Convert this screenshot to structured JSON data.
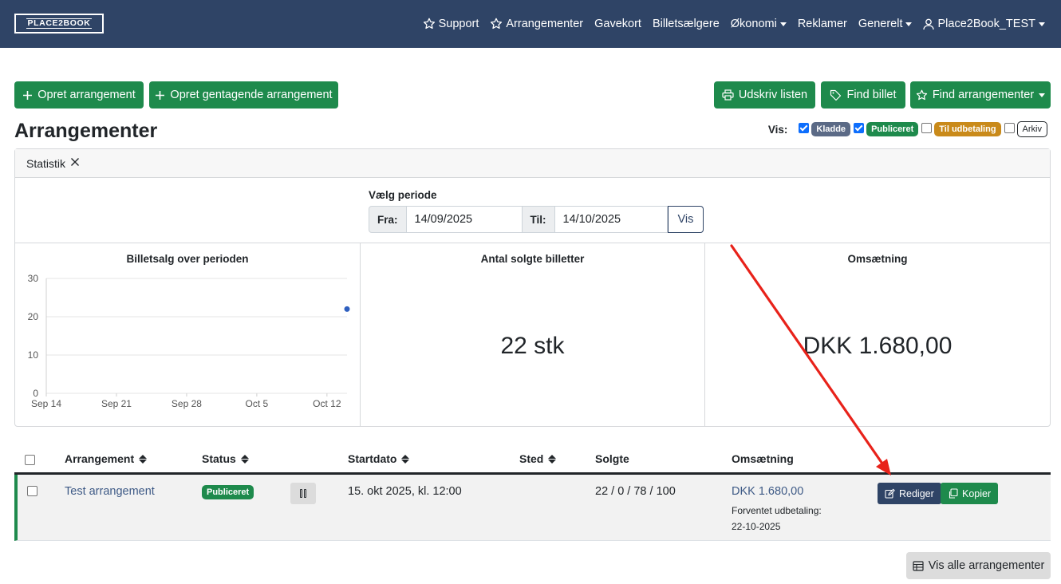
{
  "nav": {
    "logo": "PLACE2BOOK",
    "items": [
      {
        "label": "Support",
        "icon": "star-icon"
      },
      {
        "label": "Arrangementer",
        "icon": "star-icon"
      },
      {
        "label": "Gavekort"
      },
      {
        "label": "Billetsælgere"
      },
      {
        "label": "Økonomi",
        "dropdown": true
      },
      {
        "label": "Reklamer"
      },
      {
        "label": "Generelt",
        "dropdown": true
      },
      {
        "label": "Place2Book_TEST",
        "icon": "user-icon",
        "dropdown": true
      }
    ]
  },
  "toolbar": {
    "create_event": "Opret arrangement",
    "create_recurring": "Opret gentagende arrangement",
    "print_list": "Udskriv listen",
    "find_ticket": "Find billet",
    "find_events": "Find arrangementer"
  },
  "page": {
    "title": "Arrangementer"
  },
  "filter": {
    "label": "Vis:",
    "options": [
      {
        "label": "Kladde",
        "checked": true,
        "color": "#5b6a86"
      },
      {
        "label": "Publiceret",
        "checked": true,
        "color": "#1e8a4c"
      },
      {
        "label": "Til udbetaling",
        "checked": false,
        "color": "#c98a1a"
      },
      {
        "label": "Arkiv",
        "checked": false,
        "color": "#ffffff"
      }
    ]
  },
  "stats": {
    "header": "Statistik",
    "period_label": "Vælg periode",
    "from_label": "Fra:",
    "from_value": "14/09/2025",
    "to_label": "Til:",
    "to_value": "14/10/2025",
    "show_button": "Vis",
    "chart_title": "Billetsalg over perioden",
    "tickets_title": "Antal solgte billetter",
    "tickets_value": "22 stk",
    "revenue_title": "Omsætning",
    "revenue_value": "DKK 1.680,00"
  },
  "chart_data": {
    "type": "scatter",
    "title": "Billetsalg over perioden",
    "xlabel": "",
    "ylabel": "",
    "x_ticks": [
      "Sep 14",
      "Sep 21",
      "Sep 28",
      "Oct 5",
      "Oct 12"
    ],
    "y_ticks": [
      "0",
      "10",
      "20",
      "30"
    ],
    "xlim": [
      "2025-09-14",
      "2025-10-14"
    ],
    "ylim": [
      0,
      30
    ],
    "grid": true,
    "series": [
      {
        "points": [
          {
            "x": "2025-10-14",
            "y": 22
          }
        ],
        "color": "#2e5fbf"
      }
    ]
  },
  "table": {
    "headers": {
      "select": "",
      "event": "Arrangement",
      "status": "Status",
      "start": "Startdato",
      "place": "Sted",
      "sold": "Solgte",
      "revenue": "Omsætning"
    },
    "rows": [
      {
        "event": "Test arrangement",
        "status": "Publiceret",
        "start": "15. okt 2025, kl. 12:00",
        "place": "",
        "sold": "22 / 0 / 78 / 100",
        "revenue": "DKK 1.680,00",
        "payout_label": "Forventet udbetaling:",
        "payout_date": "22-10-2025",
        "edit_label": "Rediger",
        "copy_label": "Kopier"
      }
    ]
  },
  "footer": {
    "show_all": "Vis alle arrangementer"
  },
  "annotation": {
    "arrow_color": "#e8221a"
  }
}
